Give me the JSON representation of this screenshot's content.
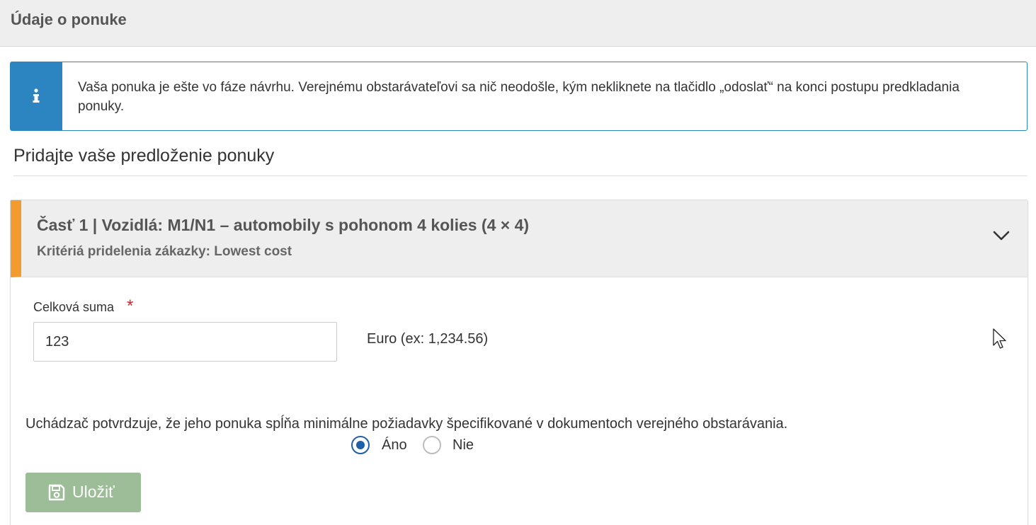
{
  "topbar": {
    "title": "Údaje o ponuke"
  },
  "info": {
    "icon": "info-icon",
    "text": "Vaša ponuka je ešte vo fáze návrhu. Verejnému obstarávateľovi sa nič neodošle, kým nekliknete na tlačidlo „odoslať“ na konci postupu predkladania ponuky."
  },
  "section": {
    "heading": "Pridajte vaše predloženie ponuky"
  },
  "lot": {
    "title": "Časť 1 | Vozidlá: M1/N1 – automobily s pohonom 4 kolies (4 × 4)",
    "criteria": "Kritériá pridelenia zákazky: Lowest cost",
    "accent_color": "#f29b2f",
    "expand_icon": "chevron-down-icon"
  },
  "form": {
    "amount_label": "Celková suma",
    "required_mark": "*",
    "amount_value": "123",
    "amount_unit_hint": "Euro (ex: 1,234.56)",
    "confirm_text": "Uchádzač potvrdzuje, že jeho ponuka spĺňa minimálne požiadavky špecifikované v dokumentoch verejného obstarávania.",
    "radio_options": [
      {
        "label": "Áno",
        "checked": true
      },
      {
        "label": "Nie",
        "checked": false
      }
    ],
    "save_label": "Uložiť",
    "save_icon": "floppy-disk-icon",
    "save_color": "#9cbd98"
  },
  "info_color": "#2c85c1"
}
